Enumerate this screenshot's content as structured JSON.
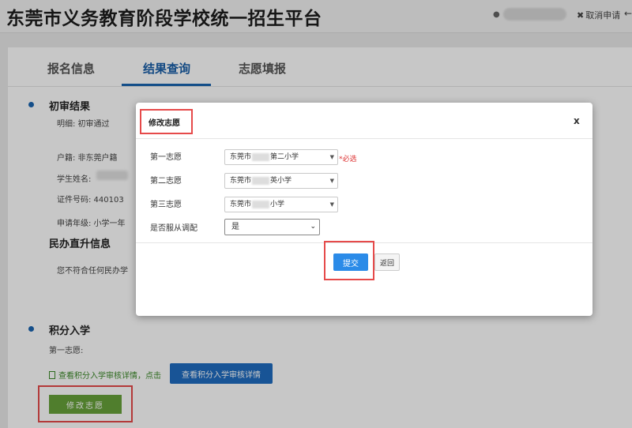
{
  "header": {
    "site_title": "东莞市义务教育阶段学校统一招生平台",
    "cancel_label": "取消申请"
  },
  "tabs": [
    {
      "label": "报名信息"
    },
    {
      "label": "结果查询"
    },
    {
      "label": "志愿填报"
    }
  ],
  "initial_review": {
    "title": "初审结果",
    "detail": "明细:  初审通过",
    "household": "户籍:  非东莞户籍",
    "student_name": "学生姓名:",
    "id_number": "证件号码:  440103",
    "grade": "申请年级:  小学一年"
  },
  "private_school": {
    "title": "民办直升信息",
    "text": "您不符合任何民办学"
  },
  "points_admission": {
    "title": "积分入学",
    "first_choice": "第一志愿:",
    "link_text": "查看积分入学审核详情，点击",
    "detail_button": "查看积分入学审核详情",
    "modify_button": "修改志愿"
  },
  "modal": {
    "title": "修改志愿",
    "close": "x",
    "fields": [
      {
        "label": "第一志愿",
        "value_prefix": "东莞市",
        "value_suffix": "第二小学"
      },
      {
        "label": "第二志愿",
        "value_prefix": "东莞市",
        "value_suffix": "英小学"
      },
      {
        "label": "第三志愿",
        "value_prefix": "东莞市",
        "value_suffix": "小学"
      }
    ],
    "required_note": "必选",
    "adjust_label": "是否服从调配",
    "adjust_value": "是",
    "submit": "提交",
    "back": "返回"
  },
  "colors": {
    "accent": "#1a64b0",
    "highlight": "#e64a4a",
    "modify_green": "#67a23a",
    "submit_blue": "#2b8be8"
  }
}
